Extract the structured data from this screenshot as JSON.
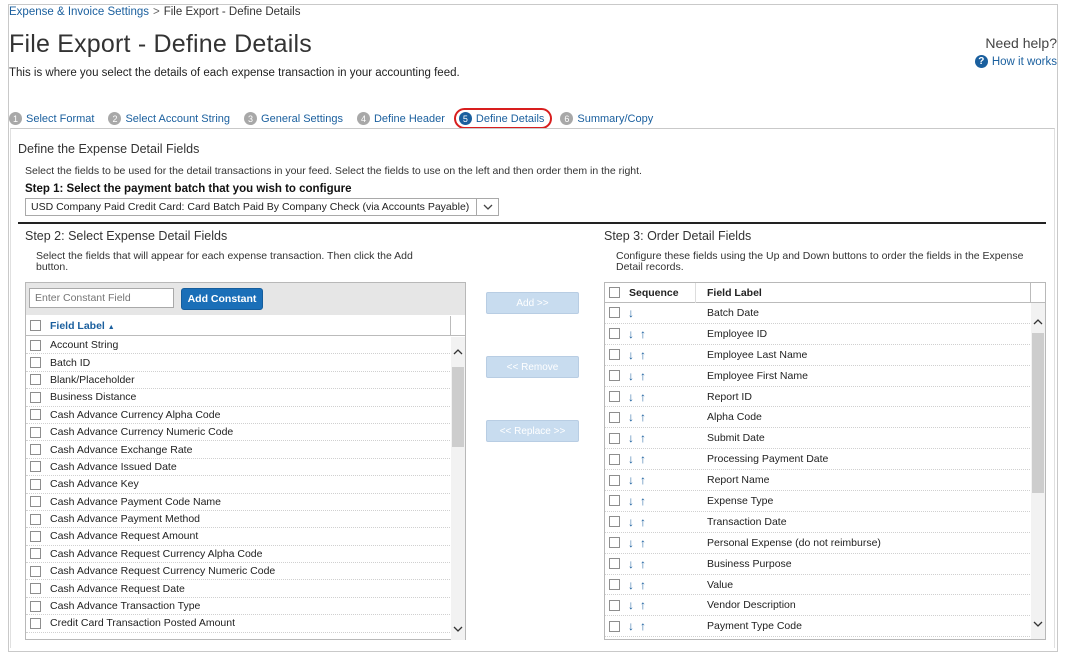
{
  "breadcrumb": {
    "parent": "Expense & Invoice Settings",
    "separator": ">",
    "current": "File Export - Define Details"
  },
  "page_title": "File Export - Define Details",
  "subtitle": "This is where you select the details of each expense transaction in your accounting feed.",
  "help": {
    "title": "Need help?",
    "link": "How it works",
    "icon": "?"
  },
  "steps": [
    {
      "num": "1",
      "label": "Select Format"
    },
    {
      "num": "2",
      "label": "Select Account String"
    },
    {
      "num": "3",
      "label": "General Settings"
    },
    {
      "num": "4",
      "label": "Define Header"
    },
    {
      "num": "5",
      "label": "Define Details"
    },
    {
      "num": "6",
      "label": "Summary/Copy"
    }
  ],
  "section": {
    "title": "Define the Expense Detail Fields",
    "desc": "Select the fields to be used for the detail transactions in your feed. Select the fields to use on the left and then order them in the right.",
    "step1_label": "Step 1: Select the payment batch that you wish to configure",
    "batch_value": "USD Company Paid Credit Card: Card Batch Paid By Company Check (via Accounts Payable)"
  },
  "step2": {
    "title": "Step 2: Select Expense Detail Fields",
    "desc": "Select the fields that will appear for each expense transaction. Then click the Add button.",
    "constant_placeholder": "Enter Constant Field",
    "add_constant": "Add Constant",
    "column": "Field Label",
    "sort_indicator": "▲",
    "fields": [
      "Account String",
      "Batch ID",
      "Blank/Placeholder",
      "Business Distance",
      "Cash Advance Currency Alpha Code",
      "Cash Advance Currency Numeric Code",
      "Cash Advance Exchange Rate",
      "Cash Advance Issued Date",
      "Cash Advance Key",
      "Cash Advance Payment Code Name",
      "Cash Advance Payment Method",
      "Cash Advance Request Amount",
      "Cash Advance Request Currency Alpha Code",
      "Cash Advance Request Currency Numeric Code",
      "Cash Advance Request Date",
      "Cash Advance Transaction Type",
      "Credit Card Transaction Posted Amount"
    ]
  },
  "buttons": {
    "add": "Add >>",
    "remove": "<< Remove",
    "replace": "<< Replace >>"
  },
  "step3": {
    "title": "Step 3: Order Detail Fields",
    "desc": "Configure these fields using the Up and Down buttons to order the fields in the Expense Detail records.",
    "col_sequence": "Sequence",
    "col_label": "Field Label",
    "down_glyph": "↓",
    "up_glyph": "↑",
    "fields": [
      "Batch Date",
      "Employee ID",
      "Employee Last Name",
      "Employee First Name",
      "Report ID",
      "Alpha Code",
      "Submit Date",
      "Processing Payment Date",
      "Report Name",
      "Expense Type",
      "Transaction Date",
      "Personal Expense (do not reimburse)",
      "Business Purpose",
      "Value",
      "Vendor Description",
      "Payment Type Code"
    ]
  },
  "colors": {
    "link": "#1a5f9e",
    "primary_button": "#1a6fb8",
    "disabled_button": "#c8dcef",
    "highlight_ring": "#d81e1e"
  }
}
